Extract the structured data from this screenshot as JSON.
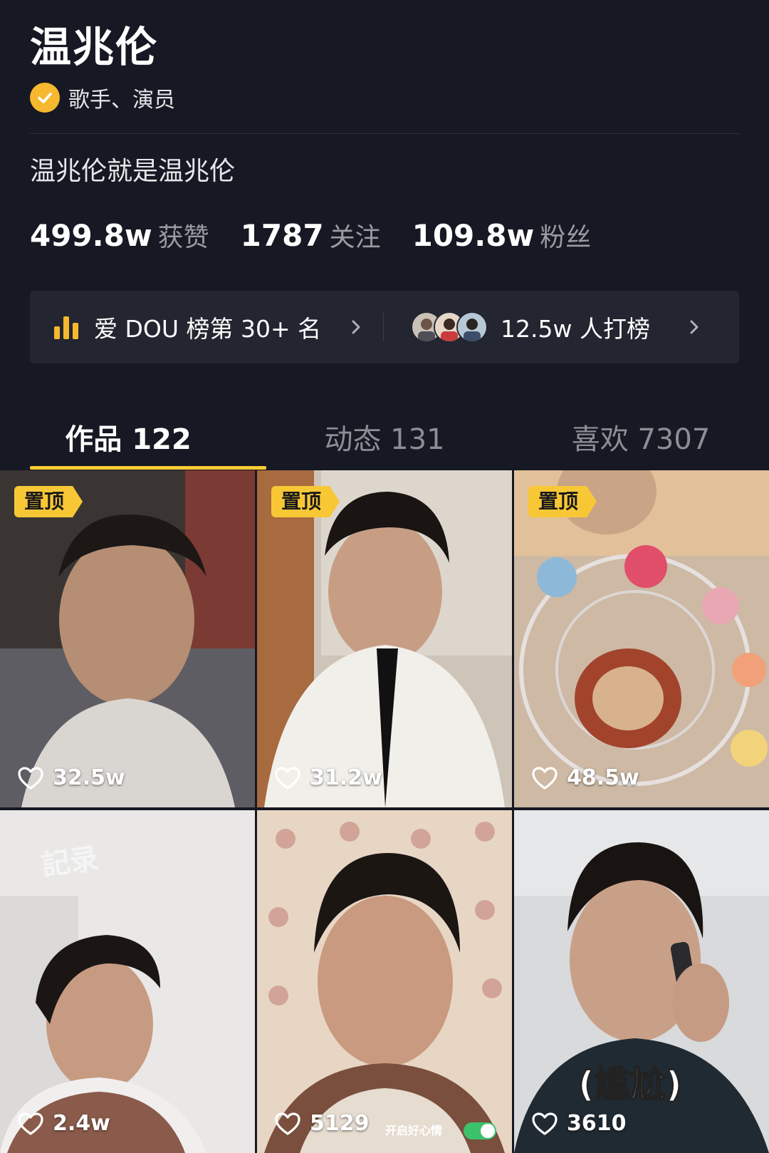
{
  "profile": {
    "name": "温兆伦",
    "verify_label": "歌手、演员",
    "bio": "温兆伦就是温兆伦",
    "stats": [
      {
        "num": "499.8w",
        "label": "获赞"
      },
      {
        "num": "1787",
        "label": "关注"
      },
      {
        "num": "109.8w",
        "label": "粉丝"
      }
    ]
  },
  "rank": {
    "left_text": "爱 DOU 榜第 30+ 名",
    "right_text": "12.5w 人打榜",
    "icon": "bar-chart-icon"
  },
  "tabs": [
    {
      "label": "作品 122",
      "active": true
    },
    {
      "label": "动态 131",
      "active": false
    },
    {
      "label": "喜欢 7307",
      "active": false
    }
  ],
  "videos": [
    {
      "pinned": true,
      "pin_label": "置顶",
      "likes": "32.5w"
    },
    {
      "pinned": true,
      "pin_label": "置顶",
      "likes": "31.2w"
    },
    {
      "pinned": true,
      "pin_label": "置顶",
      "likes": "48.5w"
    },
    {
      "pinned": false,
      "likes": "2.4w",
      "overlay": "記录"
    },
    {
      "pinned": false,
      "likes": "5129",
      "overlay": "开启好心情"
    },
    {
      "pinned": false,
      "likes": "3610",
      "overlay": "(尴尬)"
    }
  ],
  "colors": {
    "background": "#161823",
    "accent": "#facb34",
    "verify": "#f5b82e",
    "muted": "#9a9ba1"
  }
}
